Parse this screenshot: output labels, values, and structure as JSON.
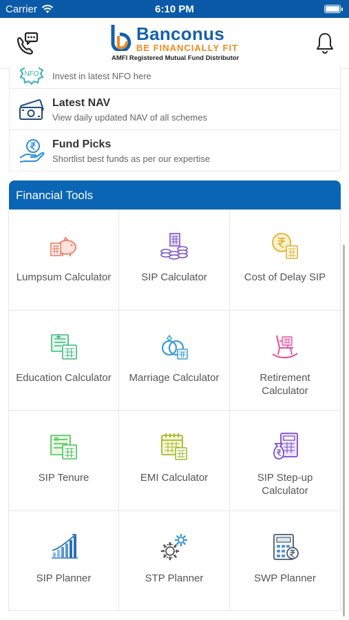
{
  "status": {
    "carrier": "Carrier",
    "time": "6:10 PM"
  },
  "header": {
    "brand": "Banconus",
    "tagline": "BE FINANCIALLY FIT",
    "subtitle": "AMFI Registered Mutual Fund Distributor",
    "colors": {
      "brand": "#1560ac",
      "tagline": "#f08a1c",
      "bar": "#0a5aa8"
    }
  },
  "menu": [
    {
      "title": "",
      "subtitle": "Invest in latest NFO here",
      "icon": "nfo-badge-icon",
      "icon_text": "NFO"
    },
    {
      "title": "Latest NAV",
      "subtitle": "View daily updated NAV of all schemes",
      "icon": "cash-icon"
    },
    {
      "title": "Fund Picks",
      "subtitle": "Shortlist best funds as per our expertise",
      "icon": "rupee-hand-icon"
    }
  ],
  "tools": {
    "title": "Financial Tools",
    "items": [
      {
        "label": "Lumpsum Calculator",
        "icon": "piggy-bank-icon"
      },
      {
        "label": "SIP Calculator",
        "icon": "coin-stack-icon"
      },
      {
        "label": "Cost of Delay SIP",
        "icon": "rupee-calculator-icon"
      },
      {
        "label": "Education Calculator",
        "icon": "education-calculator-icon"
      },
      {
        "label": "Marriage Calculator",
        "icon": "rings-icon"
      },
      {
        "label": "Retirement Calculator",
        "icon": "rocking-chair-icon"
      },
      {
        "label": "SIP Tenure",
        "icon": "tenure-calculator-icon"
      },
      {
        "label": "EMI Calculator",
        "icon": "calendar-calculator-icon"
      },
      {
        "label": "SIP Step-up Calculator",
        "icon": "money-bag-calculator-icon"
      },
      {
        "label": "SIP Planner",
        "icon": "growth-bars-icon"
      },
      {
        "label": "STP Planner",
        "icon": "gears-icon"
      },
      {
        "label": "SWP Planner",
        "icon": "calculator-rupee-icon"
      }
    ]
  }
}
